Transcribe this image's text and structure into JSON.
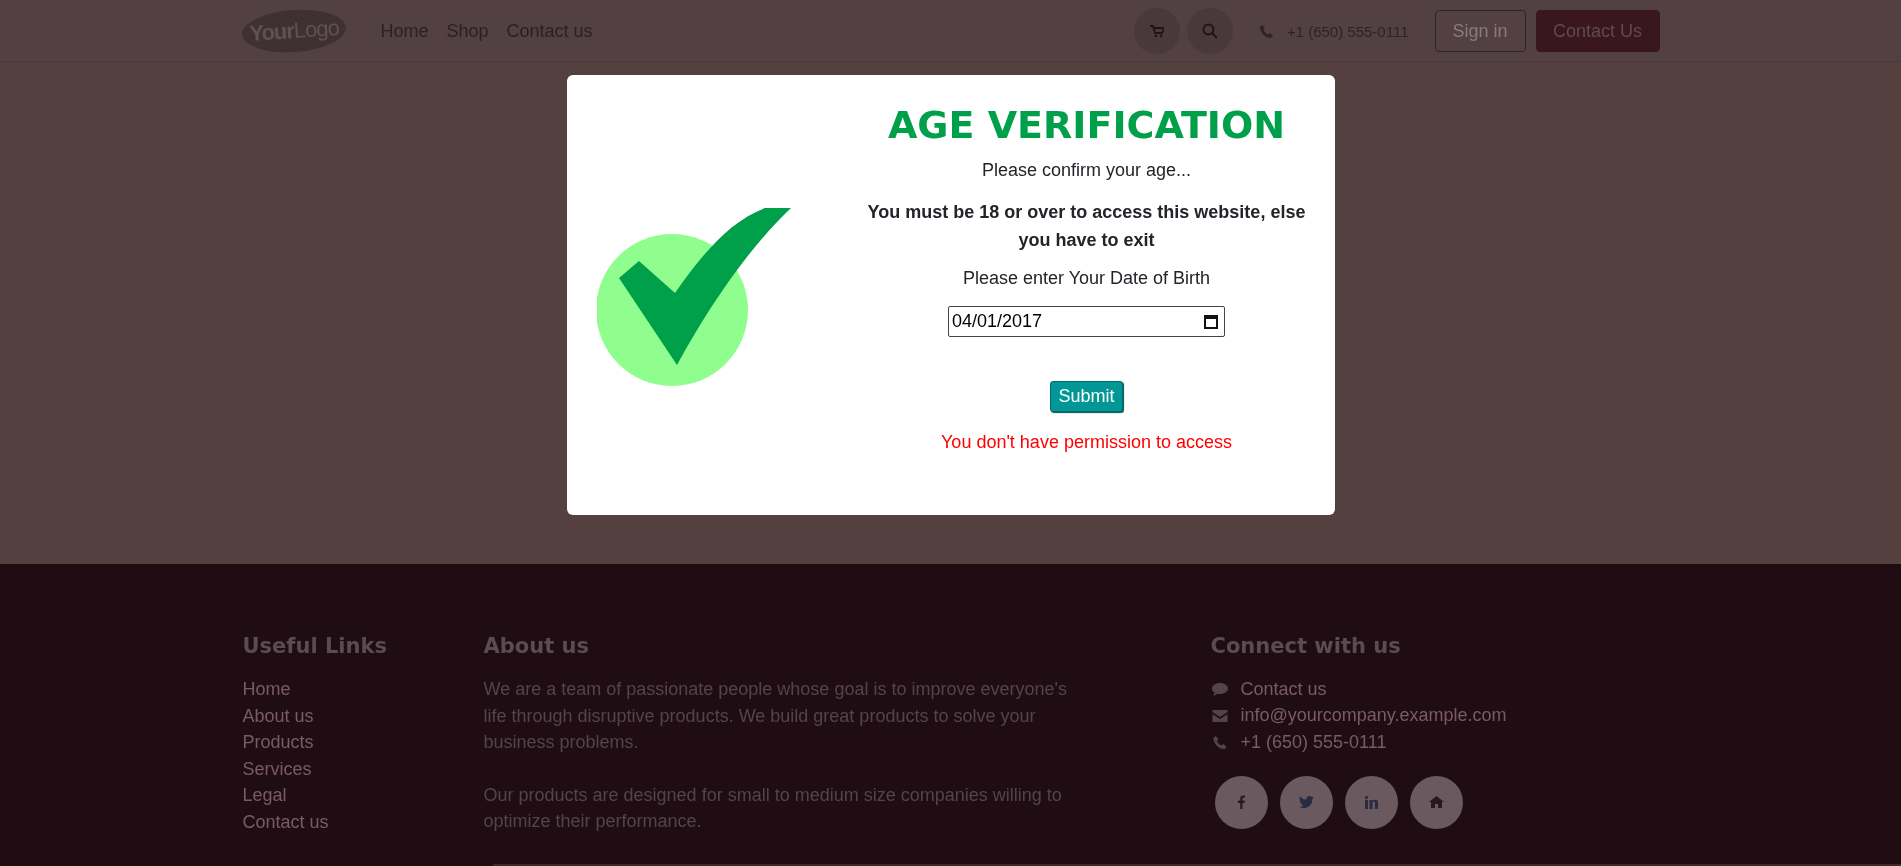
{
  "header": {
    "logo": {
      "text_1": "Your",
      "text_2": "Logo"
    },
    "nav": [
      {
        "label": "Home"
      },
      {
        "label": "Shop"
      },
      {
        "label": "Contact us"
      }
    ],
    "phone": "+1 (650) 555-0111",
    "buttons": [
      {
        "label": "Sign in",
        "kind": "outline"
      },
      {
        "label": "Contact Us",
        "kind": "primary"
      }
    ]
  },
  "modal": {
    "title": "AGE VERIFICATION",
    "subtitle": "Please confirm your age...",
    "warning": "You must be 18 or over to access this website, else you have to exit",
    "prompt": "Please enter Your Date of Birth",
    "date_field": {
      "value": "04/01/2017"
    },
    "submit": "Submit",
    "error": "You don't have permission to access"
  },
  "footer": {
    "useful_links": {
      "title": "Useful Links",
      "items": [
        "Home",
        "About us",
        "Products",
        "Services",
        "Legal",
        "Contact us"
      ]
    },
    "about": {
      "title": "About us",
      "paragraphs": [
        "We are a team of passionate people whose goal is to improve everyone's life through disruptive products. We build great products to solve your business problems.",
        "Our products are designed for small to medium size companies willing to optimize their performance."
      ]
    },
    "connect": {
      "title": "Connect with us",
      "items": [
        {
          "kind": "chat",
          "text": "Contact us"
        },
        {
          "kind": "mail",
          "text": "info@yourcompany.example.com"
        },
        {
          "kind": "phone",
          "text": "+1 (650) 555-0111"
        }
      ],
      "social": [
        {
          "kind": "facebook"
        },
        {
          "kind": "twitter"
        },
        {
          "kind": "linkedin"
        },
        {
          "kind": "home"
        }
      ]
    }
  }
}
